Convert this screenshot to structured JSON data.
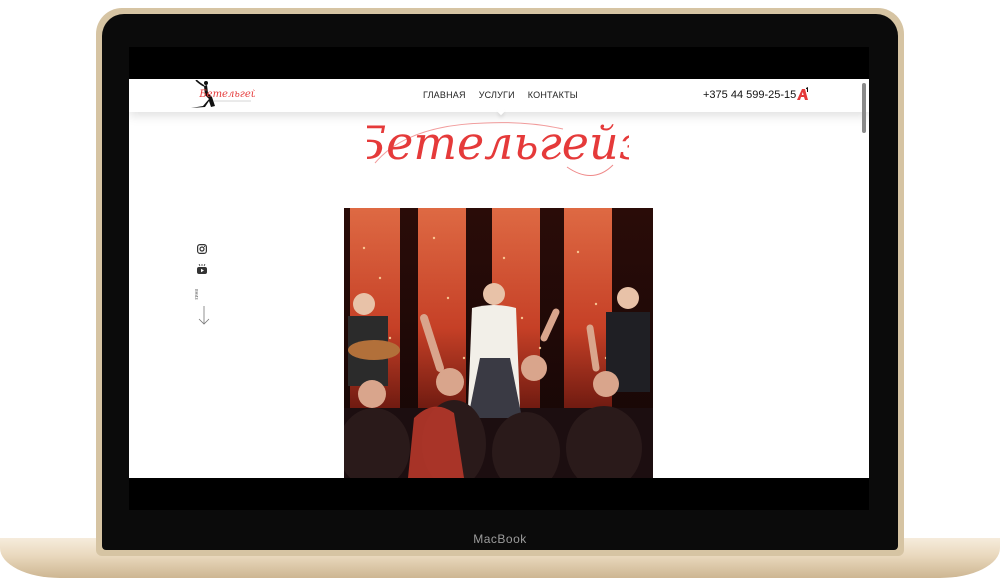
{
  "device": {
    "label": "MacBook"
  },
  "header": {
    "logo_text": "Бетельгейз",
    "nav": [
      {
        "label": "ГЛАВНАЯ"
      },
      {
        "label": "УСЛУГИ"
      },
      {
        "label": "КОНТАКТЫ"
      }
    ],
    "phone": "+375 44 599-25-15",
    "operator_icon": "a1-logo-icon"
  },
  "hero": {
    "title": "Бетельгейз",
    "scroll_label": "вниз",
    "social_icons": [
      "instagram-icon",
      "youtube-icon"
    ]
  },
  "colors": {
    "accent": "#e53a3a",
    "text": "#222222",
    "background": "#ffffff"
  }
}
